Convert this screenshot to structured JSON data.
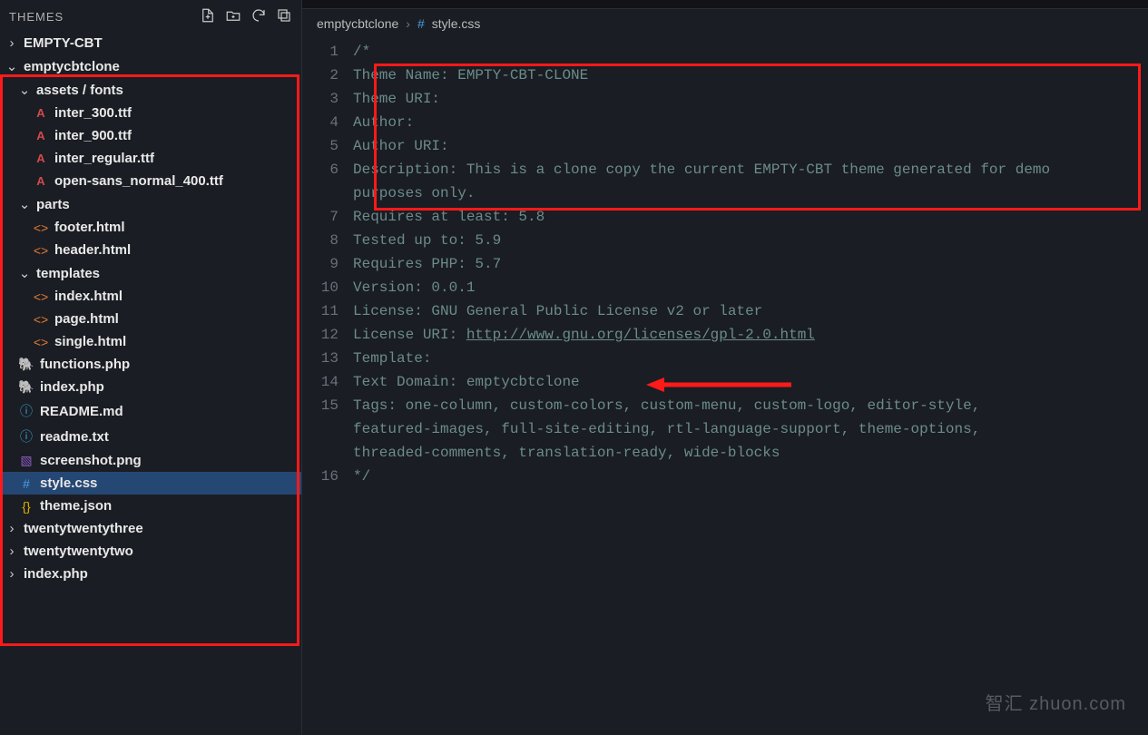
{
  "explorer": {
    "title": "THEMES",
    "items": [
      {
        "label": "EMPTY-CBT",
        "chev": "›",
        "indent": "ind1",
        "icon": ""
      },
      {
        "label": "emptycbtclone",
        "chev": "⌄",
        "indent": "ind1",
        "icon": ""
      },
      {
        "label": "assets / fonts",
        "chev": "⌄",
        "indent": "ind2",
        "icon": ""
      },
      {
        "label": "inter_300.ttf",
        "indent": "ind3",
        "icon": "A",
        "iconClass": "ic-font"
      },
      {
        "label": "inter_900.ttf",
        "indent": "ind3",
        "icon": "A",
        "iconClass": "ic-font"
      },
      {
        "label": "inter_regular.ttf",
        "indent": "ind3",
        "icon": "A",
        "iconClass": "ic-font"
      },
      {
        "label": "open-sans_normal_400.ttf",
        "indent": "ind3",
        "icon": "A",
        "iconClass": "ic-font"
      },
      {
        "label": "parts",
        "chev": "⌄",
        "indent": "ind2",
        "icon": ""
      },
      {
        "label": "footer.html",
        "indent": "ind3",
        "icon": "<>",
        "iconClass": "ic-html"
      },
      {
        "label": "header.html",
        "indent": "ind3",
        "icon": "<>",
        "iconClass": "ic-html"
      },
      {
        "label": "templates",
        "chev": "⌄",
        "indent": "ind2",
        "icon": ""
      },
      {
        "label": "index.html",
        "indent": "ind3",
        "icon": "<>",
        "iconClass": "ic-html"
      },
      {
        "label": "page.html",
        "indent": "ind3",
        "icon": "<>",
        "iconClass": "ic-html"
      },
      {
        "label": "single.html",
        "indent": "ind3",
        "icon": "<>",
        "iconClass": "ic-html"
      },
      {
        "label": "functions.php",
        "indent": "ind2",
        "icon": "🐘",
        "iconClass": "ic-php"
      },
      {
        "label": "index.php",
        "indent": "ind2",
        "icon": "🐘",
        "iconClass": "ic-php"
      },
      {
        "label": "README.md",
        "indent": "ind2",
        "icon": "ⓘ",
        "iconClass": "ic-info"
      },
      {
        "label": "readme.txt",
        "indent": "ind2",
        "icon": "ⓘ",
        "iconClass": "ic-info"
      },
      {
        "label": "screenshot.png",
        "indent": "ind2",
        "icon": "▧",
        "iconClass": "ic-img"
      },
      {
        "label": "style.css",
        "indent": "ind2",
        "icon": "#",
        "iconClass": "ic-css",
        "selected": true
      },
      {
        "label": "theme.json",
        "indent": "ind2",
        "icon": "{}",
        "iconClass": "ic-json"
      },
      {
        "label": "twentytwentythree",
        "chev": "›",
        "indent": "ind1",
        "icon": ""
      },
      {
        "label": "twentytwentytwo",
        "chev": "›",
        "indent": "ind1",
        "icon": ""
      },
      {
        "label": "index.php",
        "chev": "›",
        "indent": "ind1",
        "icon": ""
      }
    ]
  },
  "breadcrumb": {
    "root": "emptycbtclone",
    "sep": "›",
    "icon": "#",
    "file": "style.css"
  },
  "code": {
    "lines": [
      {
        "n": "1",
        "t": "/*"
      },
      {
        "n": "2",
        "t": "Theme Name: EMPTY-CBT-CLONE"
      },
      {
        "n": "3",
        "t": "Theme URI:"
      },
      {
        "n": "4",
        "t": "Author:"
      },
      {
        "n": "5",
        "t": "Author URI:"
      },
      {
        "n": "6",
        "t": "Description: This is a clone copy the current EMPTY-CBT theme generated for demo"
      },
      {
        "n": "",
        "t": "purposes only.",
        "wrap": true
      },
      {
        "n": "7",
        "t": "Requires at least: 5.8"
      },
      {
        "n": "8",
        "t": "Tested up to: 5.9"
      },
      {
        "n": "9",
        "t": "Requires PHP: 5.7"
      },
      {
        "n": "10",
        "t": "Version: 0.0.1"
      },
      {
        "n": "11",
        "t": "License: GNU General Public License v2 or later"
      },
      {
        "n": "12",
        "t": "License URI: ",
        "link": "http://www.gnu.org/licenses/gpl-2.0.html"
      },
      {
        "n": "13",
        "t": "Template:"
      },
      {
        "n": "14",
        "t": "Text Domain: emptycbtclone"
      },
      {
        "n": "15",
        "t": "Tags: one-column, custom-colors, custom-menu, custom-logo, editor-style,"
      },
      {
        "n": "",
        "t": "featured-images, full-site-editing, rtl-language-support, theme-options,",
        "wrap": true
      },
      {
        "n": "",
        "t": "threaded-comments, translation-ready, wide-blocks",
        "wrap": true
      },
      {
        "n": "16",
        "t": "*/"
      }
    ]
  },
  "watermark": "智汇 zhuon.com"
}
